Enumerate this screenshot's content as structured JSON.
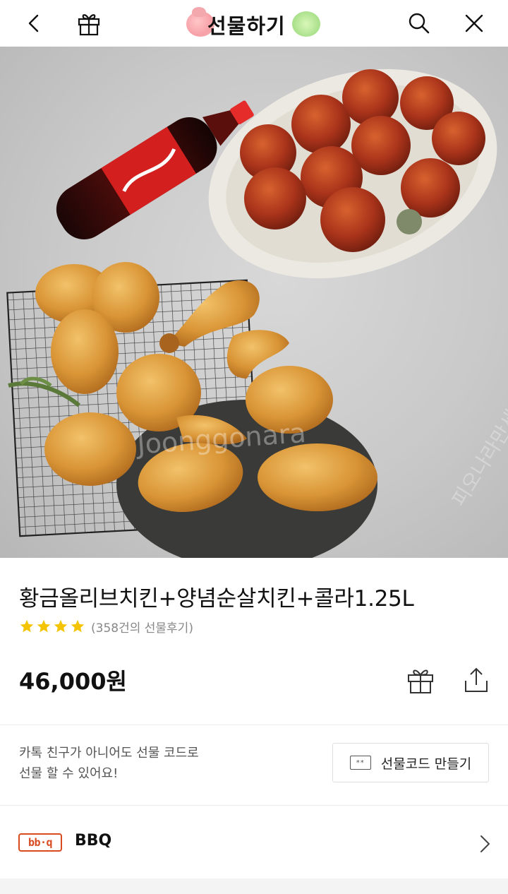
{
  "header": {
    "title": "선물하기",
    "back_icon": "chevron-left-icon",
    "gift_icon": "gift-box-icon",
    "search_icon": "search-icon",
    "close_icon": "close-icon"
  },
  "hero": {
    "watermark_text": "Joonggonara",
    "watermark_side": "피오나라만세"
  },
  "product": {
    "name": "황금올리브치킨+양념순살치킨+콜라1.25L",
    "rating_stars": 4,
    "review_count": "(358건의 선물후기)",
    "price": "46,000원",
    "star_color": "#f5c400"
  },
  "gift_code": {
    "note_line1": "카톡 친구가 아니어도 선물 코드로",
    "note_line2": "선물 할 수 있어요!",
    "button_label": "선물코드 만들기",
    "button_icon_text": "**"
  },
  "brand": {
    "logo_text": "bb·q",
    "name": "BBQ",
    "logo_color": "#d94a1e"
  }
}
